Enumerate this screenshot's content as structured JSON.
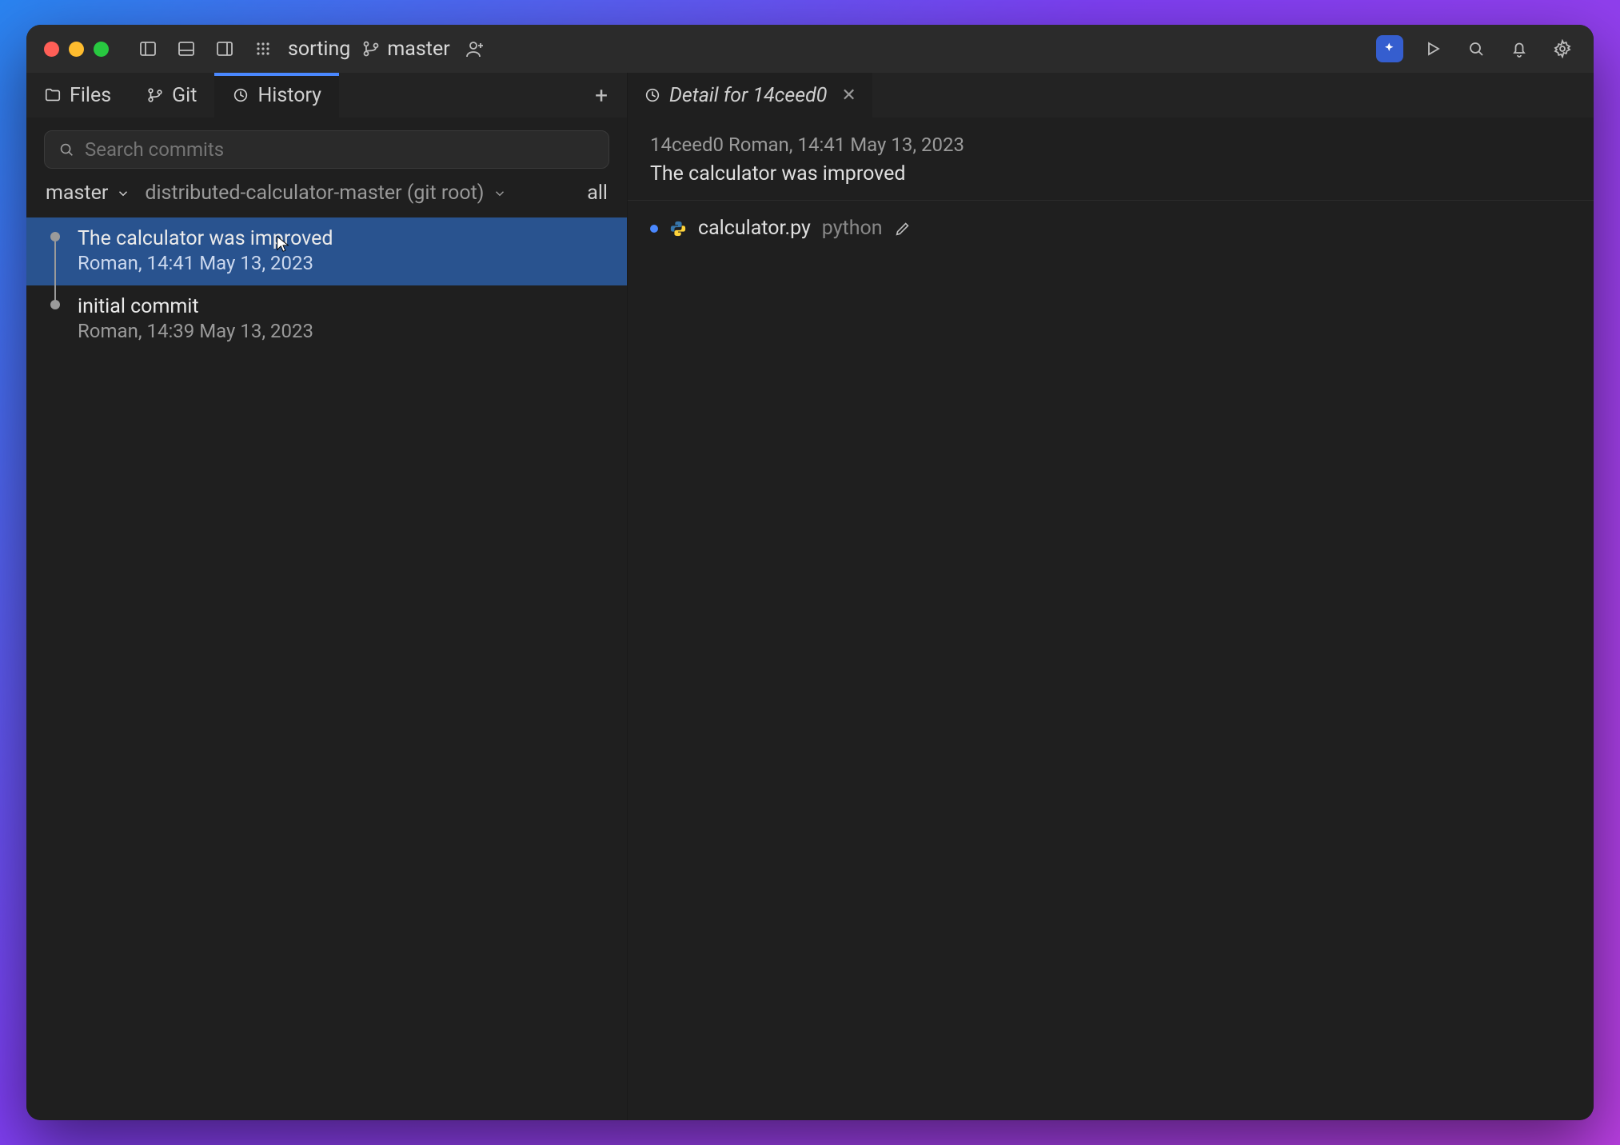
{
  "project": "sorting",
  "branch": "master",
  "tabs": {
    "files": "Files",
    "git": "Git",
    "history": "History",
    "active": "history"
  },
  "search": {
    "placeholder": "Search commits"
  },
  "filters": {
    "branch": "master",
    "root": "distributed-calculator-master (git root)",
    "all": "all"
  },
  "commits": [
    {
      "title": "The calculator was improved",
      "meta": "Roman, 14:41 May 13, 2023",
      "selected": true
    },
    {
      "title": "initial commit",
      "meta": "Roman, 14:39 May 13, 2023",
      "selected": false
    }
  ],
  "detail": {
    "tab_label": "Detail for 14ceed0",
    "hash_line": "14ceed0 Roman, 14:41 May 13, 2023",
    "message": "The calculator was improved",
    "files": [
      {
        "name": "calculator.py",
        "dir": "python"
      }
    ]
  }
}
